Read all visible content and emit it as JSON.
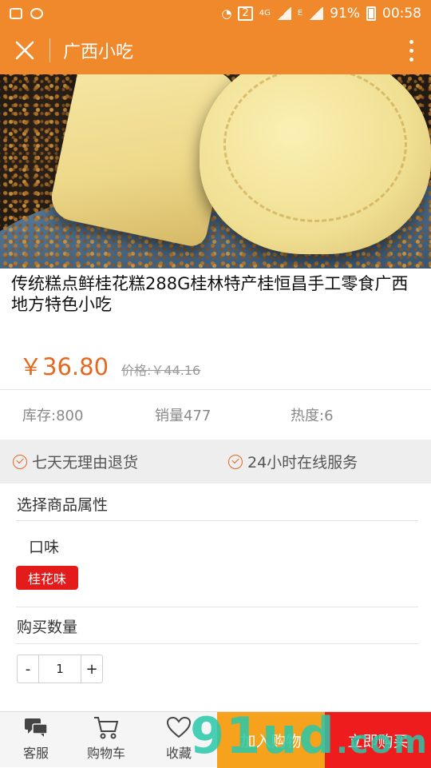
{
  "status_bar": {
    "sim_badge": "2",
    "network": "4G",
    "network2": "E",
    "battery": "91%",
    "time": "00:58"
  },
  "app_bar": {
    "title": "广西小吃"
  },
  "product": {
    "title": "传统糕点鲜桂花糕288G桂林特产桂恒昌手工零食广西地方特色小吃",
    "price": "￥36.80",
    "old_price": "价格:￥44.16"
  },
  "stats": {
    "stock": "库存:800",
    "sales": "销量477",
    "heat": "热度:6"
  },
  "service": {
    "return_policy": "七天无理由退货",
    "online_service": "24小时在线服务"
  },
  "options": {
    "section_title": "选择商品属性",
    "flavor_label": "口味",
    "flavor_value": "桂花味"
  },
  "quantity": {
    "section_title": "购买数量",
    "minus": "-",
    "value": "1",
    "plus": "+"
  },
  "bottom_bar": {
    "service_label": "客服",
    "cart_label": "购物车",
    "favorite_label": "收藏",
    "add_to_cart": "加入购物",
    "buy_now": "立即购买"
  },
  "watermark": {
    "text": "91ud",
    "suffix": ".com"
  },
  "colors": {
    "header": "#f0892b",
    "price": "#e8671e",
    "buy": "#ee1c1c",
    "cart": "#f6a21c",
    "chip": "#e31b1b"
  }
}
